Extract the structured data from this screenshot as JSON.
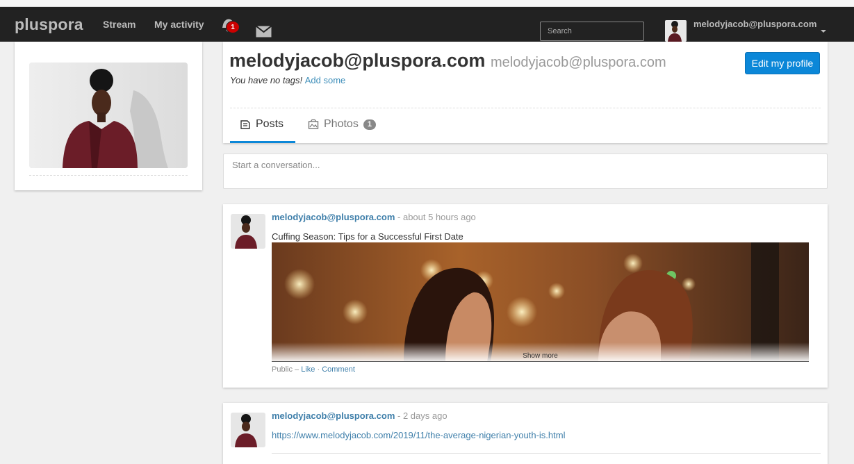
{
  "nav": {
    "brand": "pluspora",
    "stream": "Stream",
    "my_activity": "My activity",
    "notification_count": "1",
    "search_placeholder": "Search",
    "user_email": "melodyjacob@pluspora.com"
  },
  "profile": {
    "name": "melodyjacob@pluspora.com",
    "handle": "melodyjacob@pluspora.com",
    "no_tags_text": "You have no tags!",
    "add_tags_link": "Add some",
    "edit_button": "Edit my profile",
    "tabs": {
      "posts": "Posts",
      "photos": "Photos",
      "photos_count": "1"
    }
  },
  "composer": {
    "placeholder": "Start a conversation..."
  },
  "posts": [
    {
      "author": "melodyjacob@pluspora.com",
      "time": "about 5 hours ago",
      "text": "Cuffing Season: Tips for a Successful First Date",
      "show_more": "Show more",
      "visibility": "Public",
      "like": "Like",
      "comment": "Comment"
    },
    {
      "author": "melodyjacob@pluspora.com",
      "time": "2 days ago",
      "link": "https://www.melodyjacob.com/2019/11/the-average-nigerian-youth-is.html"
    }
  ],
  "colors": {
    "navbar": "#222222",
    "accent": "#0b87d8",
    "link": "#3f7faa",
    "badge": "#cc0000"
  }
}
